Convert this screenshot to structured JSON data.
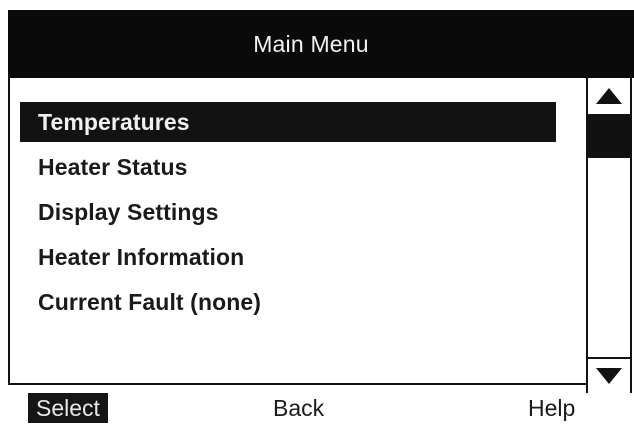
{
  "header": {
    "title": "Main Menu"
  },
  "menu": {
    "items": [
      {
        "label": "Temperatures",
        "selected": true
      },
      {
        "label": "Heater Status",
        "selected": false
      },
      {
        "label": "Display Settings",
        "selected": false
      },
      {
        "label": "Heater Information",
        "selected": false
      },
      {
        "label": "Current Fault (none)",
        "selected": false
      }
    ]
  },
  "scrollbar": {
    "up_icon": "triangle-up-icon",
    "down_icon": "triangle-down-icon"
  },
  "softkeys": {
    "select_label": "Select",
    "back_label": "Back",
    "help_label": "Help"
  },
  "colors": {
    "screen_bg": "#ffffff",
    "bar_dark": "#0a0a0a",
    "highlight": "#121212",
    "text_dark": "#1a1a1a",
    "text_light": "#f0f0f0"
  }
}
